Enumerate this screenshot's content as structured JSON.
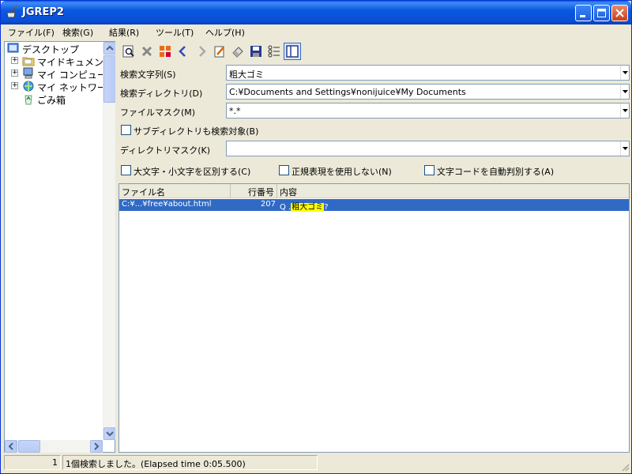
{
  "window": {
    "title": "JGREP2"
  },
  "menu": [
    "ファイル(F)",
    "検索(G)",
    "結果(R)",
    "ツール(T)",
    "ヘルプ(H)"
  ],
  "tree": {
    "items": [
      {
        "label": "デスクトップ",
        "icon": "desktop-icon"
      },
      {
        "label": "マイドキュメント",
        "icon": "folder-icon"
      },
      {
        "label": "マイ コンピュータ",
        "icon": "computer-icon"
      },
      {
        "label": "マイ ネットワーク",
        "icon": "network-icon"
      },
      {
        "label": "ごみ箱",
        "icon": "recycle-bin-icon"
      }
    ]
  },
  "toolbar": [
    "search-icon",
    "stop-icon",
    "grid-icon",
    "prev-icon",
    "next-icon",
    "edit-icon",
    "eraser-icon",
    "save-icon",
    "list-icon",
    "panel-icon"
  ],
  "form": {
    "search_text_label": "検索文字列(S)",
    "search_text_value": "粗大ゴミ",
    "search_dir_label": "検索ディレクトリ(D)",
    "search_dir_value": "C:¥Documents and Settings¥nonijuice¥My Documents",
    "file_mask_label": "ファイルマスク(M)",
    "file_mask_value": "*.*",
    "subdir_label": "サブディレクトリも検索対象(B)",
    "dir_mask_label": "ディレクトリマスク(K)",
    "dir_mask_value": "",
    "case_label": "大文字・小文字を区別する(C)",
    "regex_label": "正規表現を使用しない(N)",
    "encoding_label": "文字コードを自動判別する(A)"
  },
  "results": {
    "columns": [
      "ファイル名",
      "行番号",
      "内容"
    ],
    "rows": [
      {
        "file": "C:¥...¥free¥about.html",
        "line": "207",
        "content_prefix": "Q .",
        "content_match": "粗大ゴミ",
        "content_suffix": "?"
      }
    ]
  },
  "status": {
    "count": "1",
    "message": "1個検索しました。(Elapsed time 0:05.500)"
  }
}
